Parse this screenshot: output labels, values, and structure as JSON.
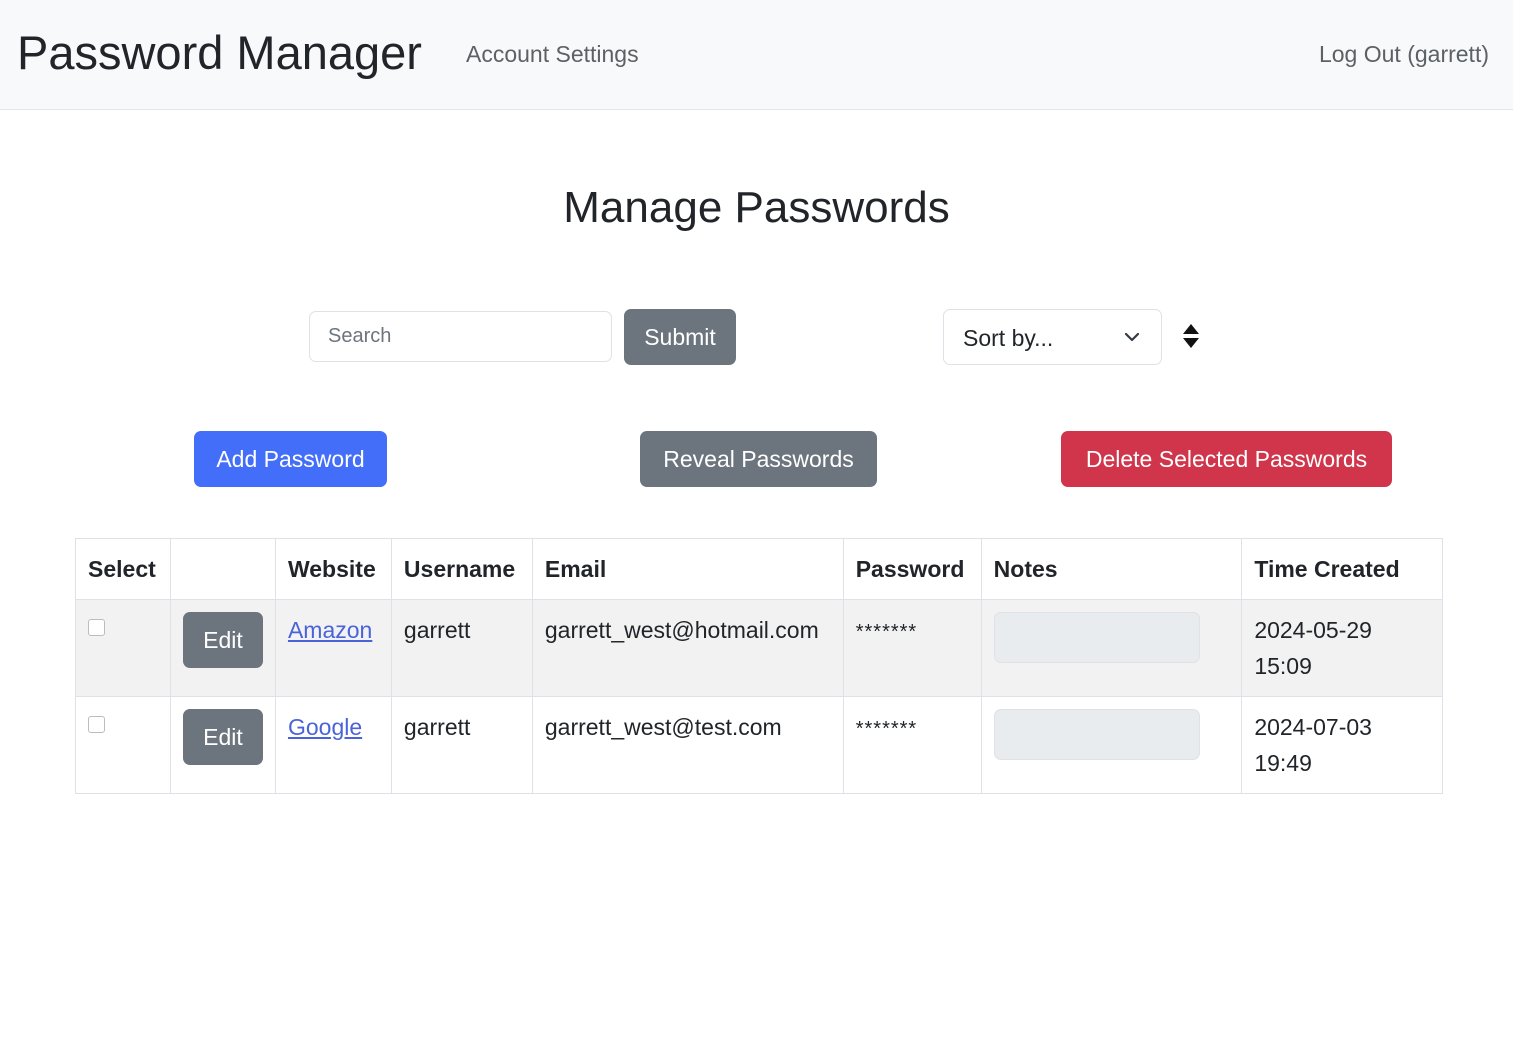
{
  "navbar": {
    "brand": "Password Manager",
    "account_settings": "Account Settings",
    "logout": "Log Out (garrett)"
  },
  "page": {
    "title": "Manage Passwords"
  },
  "search": {
    "placeholder": "Search",
    "value": "",
    "submit_label": "Submit"
  },
  "sort": {
    "selected": "Sort by...",
    "chevron_icon": "chevron-down-icon",
    "order_icon": "sort-icon"
  },
  "actions": {
    "add": "Add Password",
    "reveal": "Reveal Passwords",
    "delete": "Delete Selected Passwords"
  },
  "colors": {
    "primary": "#436efa",
    "secondary": "#6c757d",
    "danger": "#d0354b"
  },
  "table": {
    "headers": [
      "Select",
      "",
      "Website",
      "Username",
      "Email",
      "Password",
      "Notes",
      "Time Created"
    ],
    "rows": [
      {
        "checked": false,
        "edit_label": "Edit",
        "website": "Amazon",
        "username": "garrett",
        "email": "garrett_west@hotmail.com",
        "password": "*******",
        "notes": "",
        "time_created": "2024-05-29 15:09"
      },
      {
        "checked": false,
        "edit_label": "Edit",
        "website": "Google",
        "username": "garrett",
        "email": "garrett_west@test.com",
        "password": "*******",
        "notes": "",
        "time_created": "2024-07-03 19:49"
      }
    ]
  }
}
